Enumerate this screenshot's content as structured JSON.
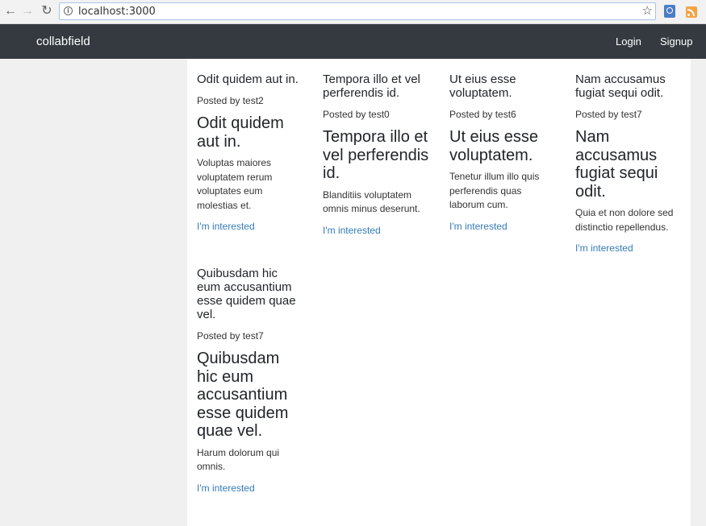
{
  "browser": {
    "url": "localhost:3000"
  },
  "navbar": {
    "brand": "collabfield",
    "login": "Login",
    "signup": "Signup"
  },
  "posts": [
    {
      "title": "Odit quidem aut in.",
      "author": "Posted by test2",
      "heading": "Odit quidem aut in.",
      "body": "Voluptas maiores voluptatem rerum voluptates eum molestias et.",
      "link": "I'm interested"
    },
    {
      "title": "Tempora illo et vel perferendis id.",
      "author": "Posted by test0",
      "heading": "Tempora illo et vel perferendis id.",
      "body": "Blanditiis voluptatem omnis minus deserunt.",
      "link": "I'm interested"
    },
    {
      "title": "Ut eius esse voluptatem.",
      "author": "Posted by test6",
      "heading": "Ut eius esse voluptatem.",
      "body": "Tenetur illum illo quis perferendis quas laborum cum.",
      "link": "I'm interested"
    },
    {
      "title": "Nam accusamus fugiat sequi odit.",
      "author": "Posted by test7",
      "heading": "Nam accusamus fugiat sequi odit.",
      "body": "Quia et non dolore sed distinctio repellendus.",
      "link": "I'm interested"
    },
    {
      "title": "Quibusdam hic eum accusantium esse quidem quae vel.",
      "author": "Posted by test7",
      "heading": "Quibusdam hic eum accusantium esse quidem quae vel.",
      "body": "Harum dolorum qui omnis.",
      "link": "I'm interested"
    }
  ]
}
